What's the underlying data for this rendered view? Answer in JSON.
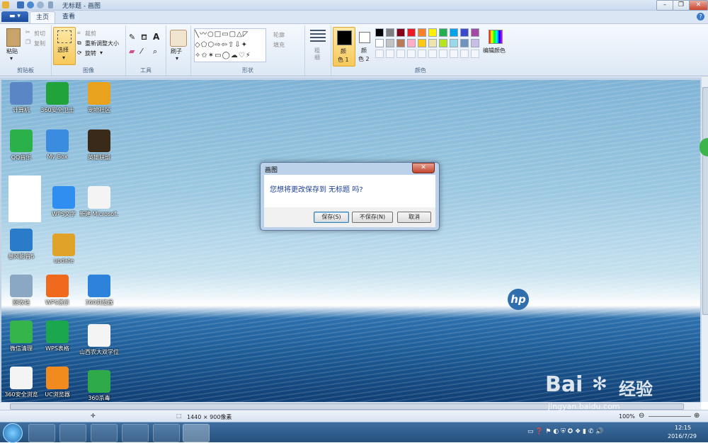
{
  "window": {
    "title": "无标题 - 画图"
  },
  "ribbon_tabs": {
    "file": "",
    "home": "主页",
    "view": "查看"
  },
  "clipboard": {
    "paste": "粘贴",
    "cut": "剪切",
    "copy": "复制",
    "group": "剪贴板"
  },
  "image": {
    "select": "选择",
    "crop": "裁剪",
    "resize": "重新调整大小",
    "rotate": "旋转",
    "group": "图像"
  },
  "tools": {
    "group": "工具"
  },
  "brushes": {
    "label": "刷子"
  },
  "shapes": {
    "outline": "轮廓",
    "fill": "填充",
    "group": "形状"
  },
  "size": {
    "label1": "粗",
    "label2": "细"
  },
  "colors": {
    "color1_a": "颜",
    "color1_b": "色 1",
    "color2_a": "颜",
    "color2_b": "色 2",
    "edit": "编辑颜色",
    "group": "颜色",
    "palette": [
      "#000000",
      "#7f7f7f",
      "#880015",
      "#ed1c24",
      "#ff7f27",
      "#fff200",
      "#22b14c",
      "#00a2e8",
      "#3f48cc",
      "#a349a4",
      "#ffffff",
      "#c3c3c3",
      "#b97a57",
      "#ffaec9",
      "#ffc90e",
      "#efe4b0",
      "#b5e61d",
      "#99d9ea",
      "#7092be",
      "#c8bfe7"
    ]
  },
  "desktop_icons": [
    {
      "label": "计算机"
    },
    {
      "label": "360安全卫士"
    },
    {
      "label": "宠物社区"
    },
    {
      "label": "QQ音乐"
    },
    {
      "label": "My Box"
    },
    {
      "label": "英雄联盟"
    },
    {
      "label": "WPS文字"
    },
    {
      "label": "新建 Microsof..."
    },
    {
      "label": "暴风影音5"
    },
    {
      "label": "update"
    },
    {
      "label": "回收站"
    },
    {
      "label": "WPS演示"
    },
    {
      "label": "360浏览器"
    },
    {
      "label": "微信清理"
    },
    {
      "label": "WPS表格"
    },
    {
      "label": "山西农大双学位金融..."
    },
    {
      "label": "360安全浏览"
    },
    {
      "label": "UC浏览器"
    },
    {
      "label": "360杀毒"
    }
  ],
  "dialog": {
    "title": "画图",
    "close": "✕",
    "message": "您想将更改保存到 无标题 吗?",
    "save": "保存(S)",
    "dont_save": "不保存(N)",
    "cancel": "取消"
  },
  "status": {
    "dimensions": "1440 × 900像素",
    "zoom": "100%"
  },
  "tray": {
    "time": "12:15",
    "date": "2016/7/29"
  },
  "watermark": {
    "brand": "Bai",
    "suffix": "经验",
    "url": "jingyan.baidu.com"
  }
}
